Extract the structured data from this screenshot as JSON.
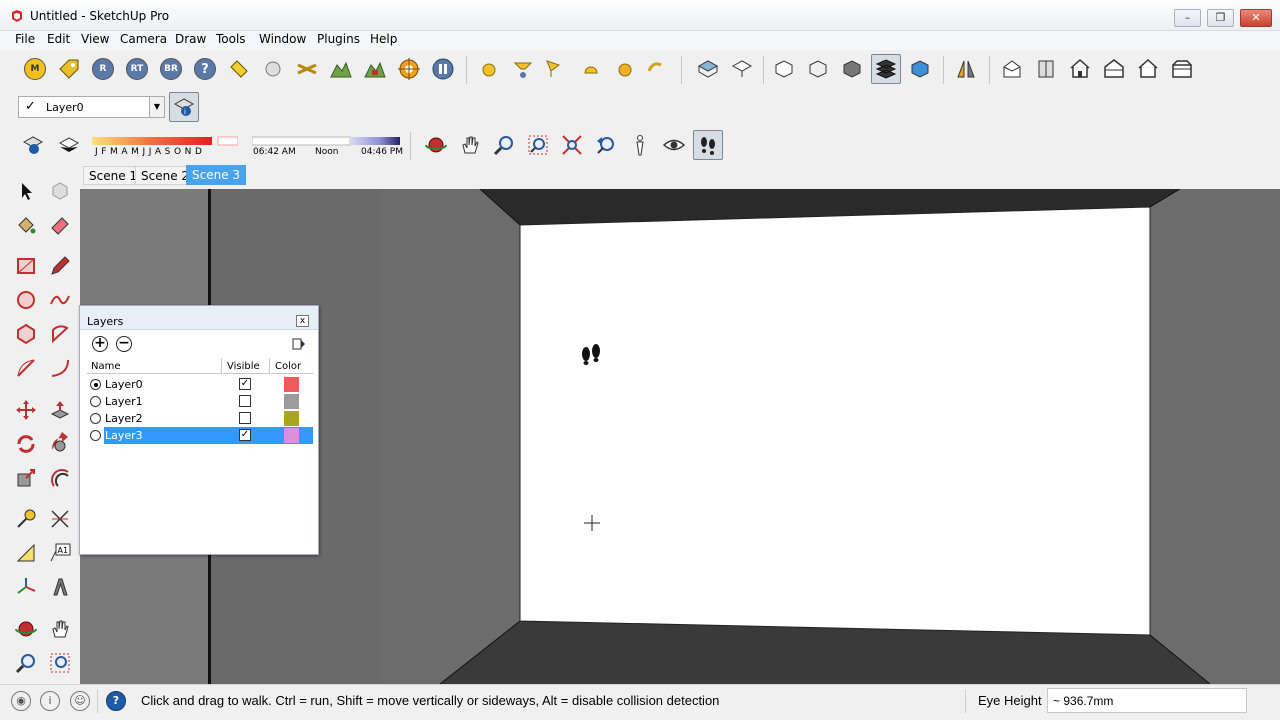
{
  "window": {
    "title": "Untitled - SketchUp Pro",
    "minimize": "–",
    "maximize": "❐",
    "close": "✕"
  },
  "menu": [
    "File",
    "Edit",
    "View",
    "Camera",
    "Draw",
    "Tools",
    "Window",
    "Plugins",
    "Help"
  ],
  "toolbar_top": {
    "plugin_icons": [
      {
        "name": "m-plugin-icon",
        "label": "M",
        "color": "#f2c21b"
      },
      {
        "name": "tag-plugin-icon",
        "label": "",
        "color": "#e8c02e"
      },
      {
        "name": "r-plugin-icon",
        "label": "R",
        "color": "#5b79a8"
      },
      {
        "name": "rt-plugin-icon",
        "label": "RT",
        "color": "#5b79a8"
      },
      {
        "name": "br-plugin-icon",
        "label": "BR",
        "color": "#5b79a8"
      },
      {
        "name": "help-plugin-icon",
        "label": "?",
        "color": "#5b79a8"
      }
    ]
  },
  "layer_dropdown": {
    "check": "✓",
    "value": "Layer0",
    "arrow": "▼"
  },
  "shadow": {
    "months": "JFMAMJJASOND",
    "time_start": "06:42 AM",
    "time_mid": "Noon",
    "time_end": "04:46 PM"
  },
  "scenes": [
    {
      "label": "Scene 1",
      "active": false
    },
    {
      "label": "Scene 2",
      "active": false
    },
    {
      "label": "Scene 3",
      "active": true
    }
  ],
  "layers_panel": {
    "title": "Layers",
    "close": "x",
    "add": "+",
    "remove": "−",
    "columns": {
      "name": "Name",
      "visible": "Visible",
      "color": "Color"
    },
    "rows": [
      {
        "name": "Layer0",
        "current": true,
        "visible": true,
        "color": "#f05a5a",
        "selected": false
      },
      {
        "name": "Layer1",
        "current": false,
        "visible": false,
        "color": "#9b9b9b",
        "selected": false
      },
      {
        "name": "Layer2",
        "current": false,
        "visible": false,
        "color": "#aaa51f",
        "selected": false
      },
      {
        "name": "Layer3",
        "current": false,
        "visible": true,
        "color": "#d98fd9",
        "selected": true
      }
    ]
  },
  "status": {
    "message": "Click and drag to walk.  Ctrl = run, Shift = move vertically or sideways, Alt = disable collision detection",
    "vcb_label": "Eye Height",
    "vcb_value": "~ 936.7mm",
    "help": "?"
  },
  "colors": {
    "viewport_bg": "#6d6d6d",
    "selection": "#3399ff",
    "wall": "#ffffff"
  }
}
